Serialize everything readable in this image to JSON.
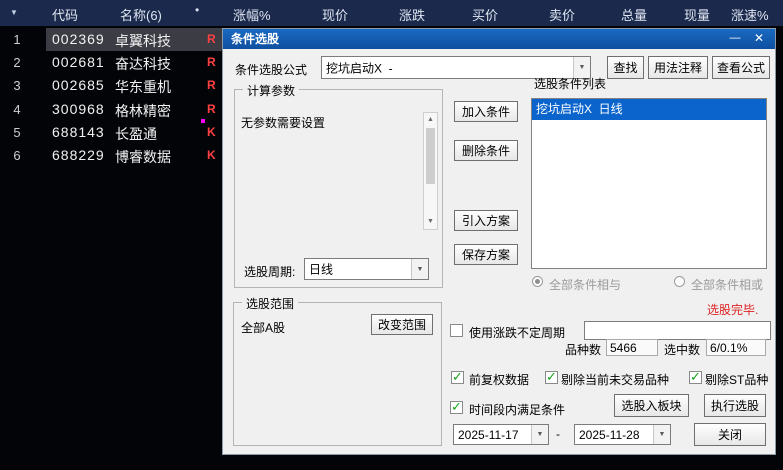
{
  "icons": {
    "sort_arrow": "▼",
    "header_dot": "•",
    "minimize": "—",
    "close": "✕",
    "dropdown": "▼",
    "scroll_up": "▲",
    "scroll_down": "▼",
    "check": "✓",
    "dash": "-"
  },
  "table": {
    "header": {
      "code": "代码",
      "name": "名称(6)",
      "pct": "涨幅%",
      "price": "现价",
      "change": "涨跌",
      "bid": "买价",
      "ask": "卖价",
      "volume": "总量",
      "cur_volume": "现量",
      "speed": "涨速%"
    },
    "rows": [
      {
        "num": "1",
        "code": "002369",
        "name": "卓翼科技",
        "flag": "R"
      },
      {
        "num": "2",
        "code": "002681",
        "name": "奋达科技",
        "flag": "R"
      },
      {
        "num": "3",
        "code": "002685",
        "name": "华东重机",
        "flag": "R"
      },
      {
        "num": "4",
        "code": "300968",
        "name": "格林精密",
        "flag": "R"
      },
      {
        "num": "5",
        "code": "688143",
        "name": "长盈通",
        "flag": "K"
      },
      {
        "num": "6",
        "code": "688229",
        "name": "博睿数据",
        "flag": "K"
      }
    ]
  },
  "dialog": {
    "title": "条件选股",
    "formula": {
      "label": "条件选股公式",
      "value": "挖坑启动X  -"
    },
    "buttons": {
      "find": "查找",
      "usage": "用法注释",
      "view_formula": "查看公式",
      "add": "加入条件",
      "remove": "删除条件",
      "import_plan": "引入方案",
      "save_plan": "保存方案",
      "change_range": "改变范围",
      "to_board": "选股入板块",
      "execute": "执行选股",
      "close": "关闭"
    },
    "params": {
      "group": "计算参数",
      "empty": "无参数需要设置",
      "period_label": "选股周期:",
      "period_value": "日线"
    },
    "range": {
      "group": "选股范围",
      "value": "全部A股"
    },
    "conditions": {
      "label": "选股条件列表",
      "item": "挖坑启动X  日线",
      "radio_and": "全部条件相与",
      "radio_or": "全部条件相或"
    },
    "status": {
      "done": "选股完毕."
    },
    "options": {
      "variable_period": "使用涨跌不定周期",
      "forward_adjusted": "前复权数据",
      "exclude_untraded": "剔除当前未交易品种",
      "exclude_st": "剔除ST品种",
      "time_range": "时间段内满足条件"
    },
    "counts": {
      "total_label": "品种数",
      "total": "5466",
      "selected_label": "选中数",
      "selected": "6/0.1%"
    },
    "dates": {
      "from": "2025-11-17",
      "to": "2025-11-28"
    }
  },
  "colors": {
    "title_bar": "#0e4f9f",
    "header_bg": "#1b2a4c",
    "selection_blue": "#0a64cc",
    "flag_red": "#ff4043",
    "status_red": "#dd2222",
    "check_green": "#17a317",
    "marker_magenta": "#ff00ff"
  }
}
